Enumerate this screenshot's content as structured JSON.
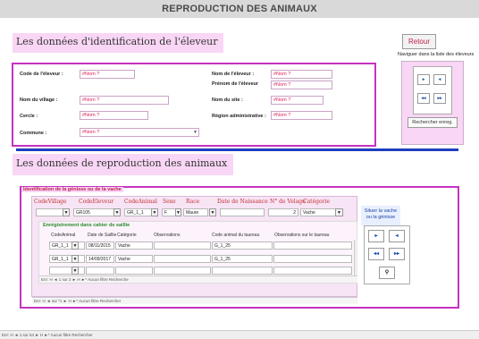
{
  "header": {
    "title": "REPRODUCTION DES ANIMAUX"
  },
  "section_eleveur": {
    "title": "Les données d'identification de l'éleveur",
    "retour": "Retour",
    "naviguer": "Naviguer  dans la liste des éleveurs",
    "labels": {
      "code": "Code de l'éleveur :",
      "village": "Nom du village :",
      "cercle": "Cercle :",
      "commune": "Commune :",
      "nom": "Nom de l'éleveur :",
      "prenom": "Prénom de l'éleveur",
      "site": "Nom du site :",
      "region": "Région administrative :"
    },
    "values": {
      "code": "#Nom ?",
      "village": "#Nom ?",
      "cercle": "#Nom ?",
      "commune": "#Nom ?",
      "nom": "#Nom ?",
      "prenom": "#Nom ?",
      "site": "#Nom ?",
      "region": "#Nom ?"
    },
    "rechercher": "Rechercher enreg."
  },
  "section_repro": {
    "title": "Les données de reproduction des animaux",
    "frame_label": "Identification de la génisse ou de la vache",
    "columns": [
      "CodeVillage",
      "CodeEleveur",
      "CodeAnimal",
      "Sexe",
      "Race",
      "Date de Naissance",
      "N° de Velage",
      "Catégorie"
    ],
    "row": {
      "village": "",
      "eleveur": "GR105",
      "animal": "GR_1_1",
      "sexe": "F",
      "race": "Maure",
      "naissance": "",
      "velage": "2",
      "categorie": "Vache"
    },
    "situer": "Situer la vache ou la génisse",
    "saillie": {
      "title": "Enrégistrement dans cahier de saillie",
      "columns": [
        "CodeAnimal",
        "Date de Saillie",
        "Catégorie",
        "Observations",
        "Code animal du taureau",
        "Observations sur le taureau"
      ],
      "rows": [
        {
          "animal": "GR_1_1",
          "date": "08/11/2015",
          "cat": "Vache",
          "obs": "",
          "taureau": "G_1_25",
          "obs_taureau": ""
        },
        {
          "animal": "GR_1_1",
          "date": "14/09/2017",
          "cat": "Vache",
          "obs": "",
          "taureau": "G_1_25",
          "obs_taureau": ""
        },
        {
          "animal": "",
          "date": "",
          "cat": "",
          "obs": "",
          "taureau": "",
          "obs_taureau": ""
        }
      ],
      "nav": "Enr: H  ◄  1 sur 2  ►  H  ►*   Aucun filtre   Recherche"
    },
    "nav_outer": "Enr: H  ◄  sur ⁰1  ►  H  ►*   Aucun filtre   Rechercher"
  },
  "bottom_nav": "Enr: H  ◄  1 sur 64  ►  H  ►*   Aucun filtre   Rechercher",
  "colors": {
    "accent_magenta": "#c632c0",
    "pink_band": "#f9d6f5",
    "field_text": "#e0205a",
    "blue_bar": "#1f3fbf"
  }
}
